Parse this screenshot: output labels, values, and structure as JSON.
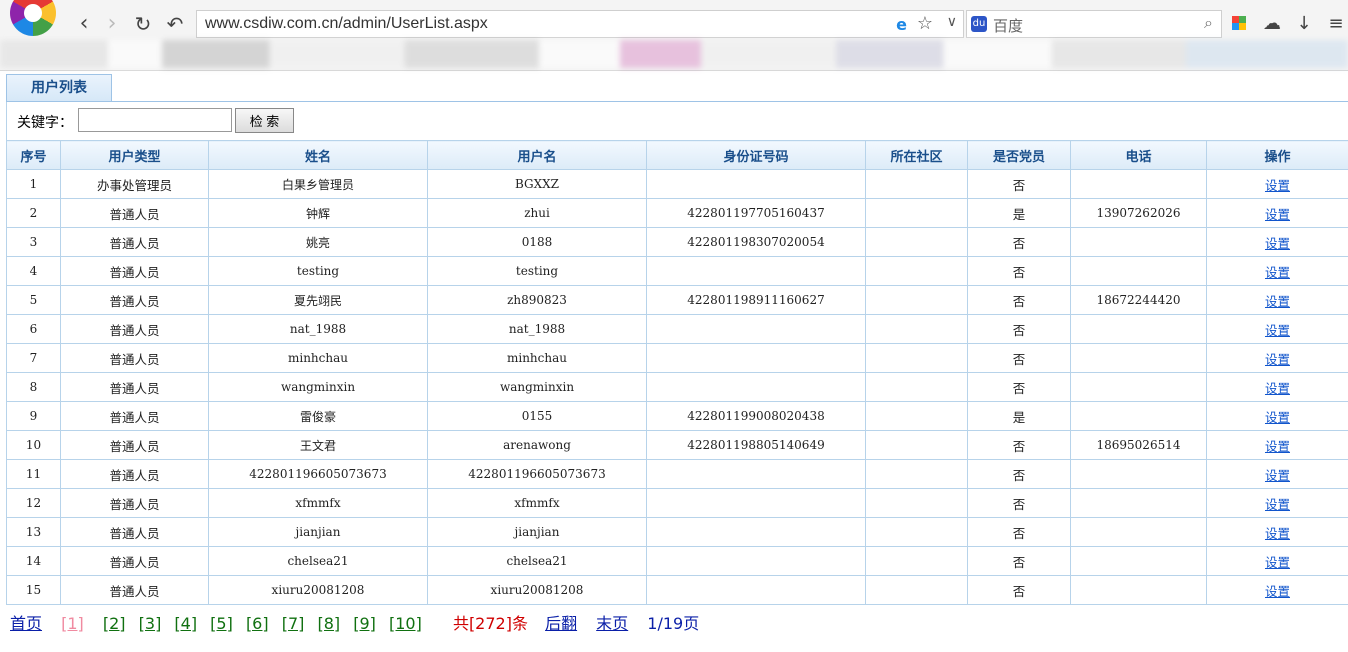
{
  "browser": {
    "url": "www.csdiw.com.cn/admin/UserList.aspx",
    "search_placeholder": "百度"
  },
  "page": {
    "tab_label": "用户列表",
    "keyword_label": "关键字：",
    "keyword_value": "",
    "search_button": "检 索"
  },
  "table": {
    "headers": [
      "序号",
      "用户类型",
      "姓名",
      "用户名",
      "身份证号码",
      "所在社区",
      "是否党员",
      "电话",
      "操作"
    ],
    "rows": [
      [
        "1",
        "办事处管理员",
        "白果乡管理员",
        "BGXXZ",
        "",
        "",
        "否",
        "",
        "设置"
      ],
      [
        "2",
        "普通人员",
        "钟辉",
        "zhui",
        "422801197705160437",
        "",
        "是",
        "13907262026",
        "设置"
      ],
      [
        "3",
        "普通人员",
        "姚亮",
        "0188",
        "422801198307020054",
        "",
        "否",
        "",
        "设置"
      ],
      [
        "4",
        "普通人员",
        "testing",
        "testing",
        "",
        "",
        "否",
        "",
        "设置"
      ],
      [
        "5",
        "普通人员",
        "夏先翊民",
        "zh890823",
        "422801198911160627",
        "",
        "否",
        "18672244420",
        "设置"
      ],
      [
        "6",
        "普通人员",
        "nat_1988",
        "nat_1988",
        "",
        "",
        "否",
        "",
        "设置"
      ],
      [
        "7",
        "普通人员",
        "minhchau",
        "minhchau",
        "",
        "",
        "否",
        "",
        "设置"
      ],
      [
        "8",
        "普通人员",
        "wangminxin",
        "wangminxin",
        "",
        "",
        "否",
        "",
        "设置"
      ],
      [
        "9",
        "普通人员",
        "雷俊豪",
        "0155",
        "422801199008020438",
        "",
        "是",
        "",
        "设置"
      ],
      [
        "10",
        "普通人员",
        "王文君",
        "arenawong",
        "422801198805140649",
        "",
        "否",
        "18695026514",
        "设置"
      ],
      [
        "11",
        "普通人员",
        "422801196605073673",
        "422801196605073673",
        "",
        "",
        "否",
        "",
        "设置"
      ],
      [
        "12",
        "普通人员",
        "xfmmfx",
        "xfmmfx",
        "",
        "",
        "否",
        "",
        "设置"
      ],
      [
        "13",
        "普通人员",
        "jianjian",
        "jianjian",
        "",
        "",
        "否",
        "",
        "设置"
      ],
      [
        "14",
        "普通人员",
        "chelsea21",
        "chelsea21",
        "",
        "",
        "否",
        "",
        "设置"
      ],
      [
        "15",
        "普通人员",
        "xiuru20081208",
        "xiuru20081208",
        "",
        "",
        "否",
        "",
        "设置"
      ]
    ]
  },
  "pager": {
    "first": "首页",
    "pages": [
      "[1]",
      "[2]",
      "[3]",
      "[4]",
      "[5]",
      "[6]",
      "[7]",
      "[8]",
      "[9]",
      "[10]"
    ],
    "total": "共[272]条",
    "next": "后翻",
    "last": "末页",
    "position": "1/19页"
  }
}
